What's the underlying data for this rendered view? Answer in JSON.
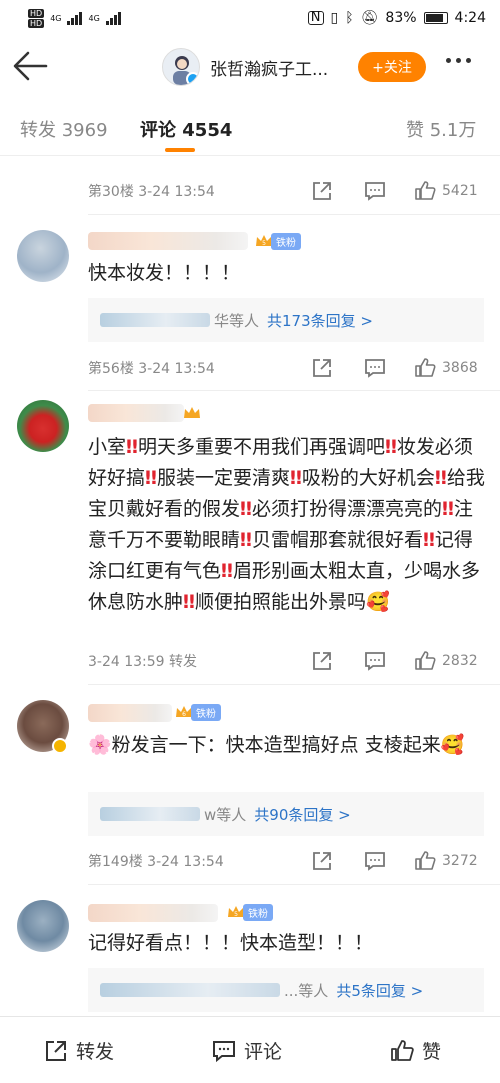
{
  "status_bar": {
    "hd1": "HD",
    "hd2": "HD",
    "net1": "4G",
    "net2": "4G",
    "battery": "83%",
    "time": "4:24"
  },
  "header": {
    "author_name": "张哲瀚疯子工...",
    "follow_label": "+关注"
  },
  "tabs": {
    "repost": "转发 3969",
    "comment": "评论 4554",
    "like": "赞 5.1万"
  },
  "comments": [
    {
      "floor_time": "第30楼  3-24 13:54",
      "likes": "5421"
    },
    {
      "badge": "铁粉",
      "text": "快本妆发！！！！",
      "reply_suffix": "华等人",
      "reply_count": "共173条回复 >",
      "floor_time": "第56楼  3-24 13:54",
      "likes": "3868"
    },
    {
      "text_html": "小室‼明天多重要不用我们再强调吧‼妆发必须好好搞‼服装一定要清爽‼吸粉的大好机会‼给我宝贝戴好看的假发‼必须打扮得漂漂亮亮的‼注意千万不要勒眼睛‼贝雷帽那套就很好看‼记得涂口红更有气色‼眉形别画太粗太直，少喝水多休息防水肿‼顺便拍照能出外景吗🥰",
      "floor_time": "3-24 13:59  转发",
      "likes": "2832"
    },
    {
      "badge": "铁粉",
      "text": "🌸粉发言一下：快本造型搞好点 支棱起来🥰",
      "reply_suffix": "w等人",
      "reply_count": "共90条回复 >",
      "floor_time": "第149楼  3-24 13:54",
      "likes": "3272"
    },
    {
      "badge": "铁粉",
      "text": "记得好看点！！！快本造型！！！",
      "reply_suffix": "...等人",
      "reply_count": "共5条回复 >",
      "floor_time": "",
      "likes": ""
    }
  ],
  "bottom_bar": {
    "repost": "转发",
    "comment": "评论",
    "like": "赞"
  },
  "colors": {
    "accent": "#ff8200",
    "link": "#2d74c7",
    "fan_badge": "#7aa9f5",
    "exclaim": "#e0242f"
  }
}
